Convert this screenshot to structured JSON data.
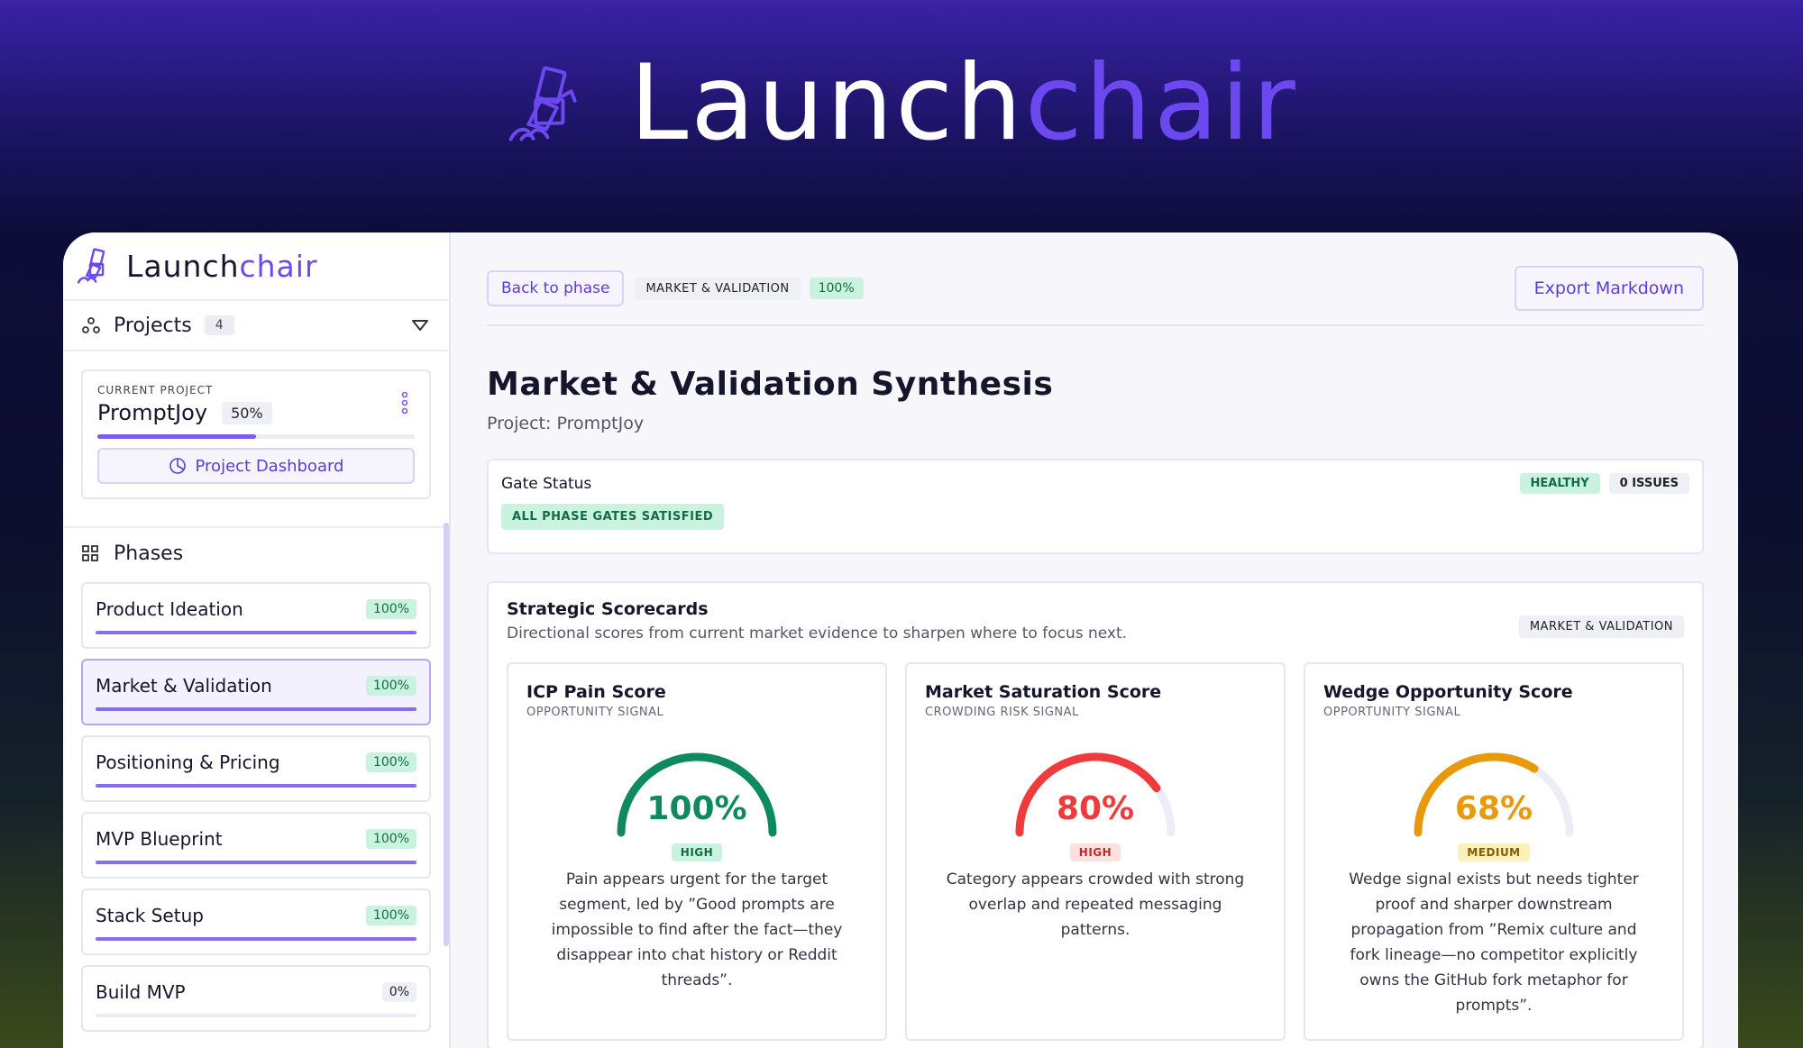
{
  "hero": {
    "brand_part1": "Launch",
    "brand_part2": "chair"
  },
  "sidebar": {
    "brand_part1": "Launch",
    "brand_part2": "chair",
    "projects_label": "Projects",
    "projects_count": "4",
    "current_project": {
      "label": "CURRENT PROJECT",
      "name": "PromptJoy",
      "progress_text": "50%",
      "progress": 0.5,
      "dashboard_button": "Project Dashboard"
    },
    "phases_label": "Phases",
    "phases": [
      {
        "name": "Product Ideation",
        "pct": "100%",
        "progress": 1.0
      },
      {
        "name": "Market & Validation",
        "pct": "100%",
        "progress": 1.0
      },
      {
        "name": "Positioning & Pricing",
        "pct": "100%",
        "progress": 1.0
      },
      {
        "name": "MVP Blueprint",
        "pct": "100%",
        "progress": 1.0
      },
      {
        "name": "Stack Setup",
        "pct": "100%",
        "progress": 1.0
      },
      {
        "name": "Build MVP",
        "pct": "0%",
        "progress": 0.0
      }
    ]
  },
  "main": {
    "back_button": "Back to phase",
    "phase_tag": "MARKET & VALIDATION",
    "phase_pct": "100%",
    "export_button": "Export Markdown",
    "title": "Market & Validation Synthesis",
    "project_line": "Project: PromptJoy",
    "gate": {
      "title": "Gate Status",
      "satisfied": "ALL PHASE GATES SATISFIED",
      "health": "HEALTHY",
      "issues": "0 ISSUES"
    },
    "scorecards": {
      "title": "Strategic Scorecards",
      "subtitle": "Directional scores from current market evidence to sharpen where to focus next.",
      "tag": "MARKET & VALIDATION",
      "cards": [
        {
          "title": "ICP Pain Score",
          "signal": "OPPORTUNITY SIGNAL",
          "value_text": "100%",
          "value": 1.0,
          "level": "HIGH",
          "color": "#0f8a5f",
          "level_bg": "#c9f3df",
          "level_fg": "#146c45",
          "desc": "Pain appears urgent for the target segment, led by ”Good prompts are impossible to find after the fact—they disappear into chat history or Reddit threads”."
        },
        {
          "title": "Market Saturation Score",
          "signal": "CROWDING RISK SIGNAL",
          "value_text": "80%",
          "value": 0.8,
          "level": "HIGH",
          "color": "#ef3b3b",
          "level_bg": "#fde0e0",
          "level_fg": "#c62828",
          "desc": "Category appears crowded with strong overlap and repeated messaging patterns."
        },
        {
          "title": "Wedge Opportunity Score",
          "signal": "OPPORTUNITY SIGNAL",
          "value_text": "68%",
          "value": 0.68,
          "level": "MEDIUM",
          "color": "#e89a0c",
          "level_bg": "#fdf0b8",
          "level_fg": "#8a5a00",
          "desc": "Wedge signal exists but needs tighter proof and sharper downstream propagation from ”Remix culture and fork lineage—no competitor explicitly owns the GitHub fork metaphor for prompts”."
        }
      ]
    }
  }
}
